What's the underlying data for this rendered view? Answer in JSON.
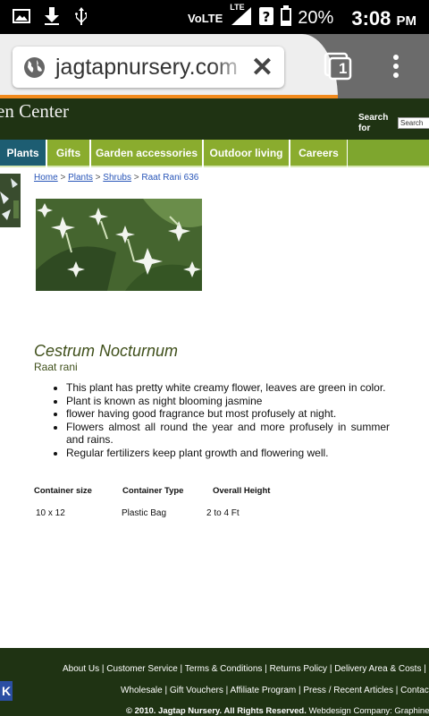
{
  "status_bar": {
    "network": "VoLTE",
    "lte": "LTE",
    "battery_pct": "20%",
    "time": "3:08",
    "ampm": "PM"
  },
  "browser": {
    "url": "jagtapnursery.com",
    "tab_count": "1"
  },
  "site": {
    "brand_fragment": "en Center",
    "search_label": "Search for",
    "search_value": "Search"
  },
  "nav": {
    "items": [
      "Plants",
      "Gifts",
      "Garden accessories",
      "Outdoor living",
      "Careers"
    ]
  },
  "breadcrumb": {
    "home": "Home",
    "plants": "Plants",
    "shrubs": "Shrubs",
    "current": "Raat Rani 636",
    "separator": ">"
  },
  "product": {
    "title": "Cestrum Nocturnum",
    "subtitle": "Raat rani",
    "bullets": [
      "This plant has pretty white creamy flower, leaves are green in color.",
      "Plant is known as night blooming jasmine",
      "flower having good fragrance but most profusely at night.",
      "Flowers almost  all round the year and more profusely in summer and rains.",
      "Regular fertilizers keep plant growth and flowering well."
    ]
  },
  "specs": {
    "headers": [
      "Container size",
      "Container Type",
      "Overall Height"
    ],
    "row": [
      "10 x 12",
      "Plastic Bag",
      "2 to 4 Ft"
    ]
  },
  "footer": {
    "links_row1": "About Us | Customer Service | Terms & Conditions | Returns Policy | Delivery Area & Costs | Cu",
    "links_row2": "Wholesale | Gift Vouchers | Affiliate Program | Press / Recent Articles | Contact",
    "copyright_bold": "© 2010. Jagtap Nursery. All Rights Reserved.",
    "copyright_rest": " Webdesign Company: Graphine",
    "icon_letter": "K"
  },
  "colors": {
    "header_bg": "#1f3313",
    "nav_active": "#1d5d72",
    "nav_green": "#8aac2e",
    "link": "#2855b8",
    "progress": "#f28a1c"
  }
}
